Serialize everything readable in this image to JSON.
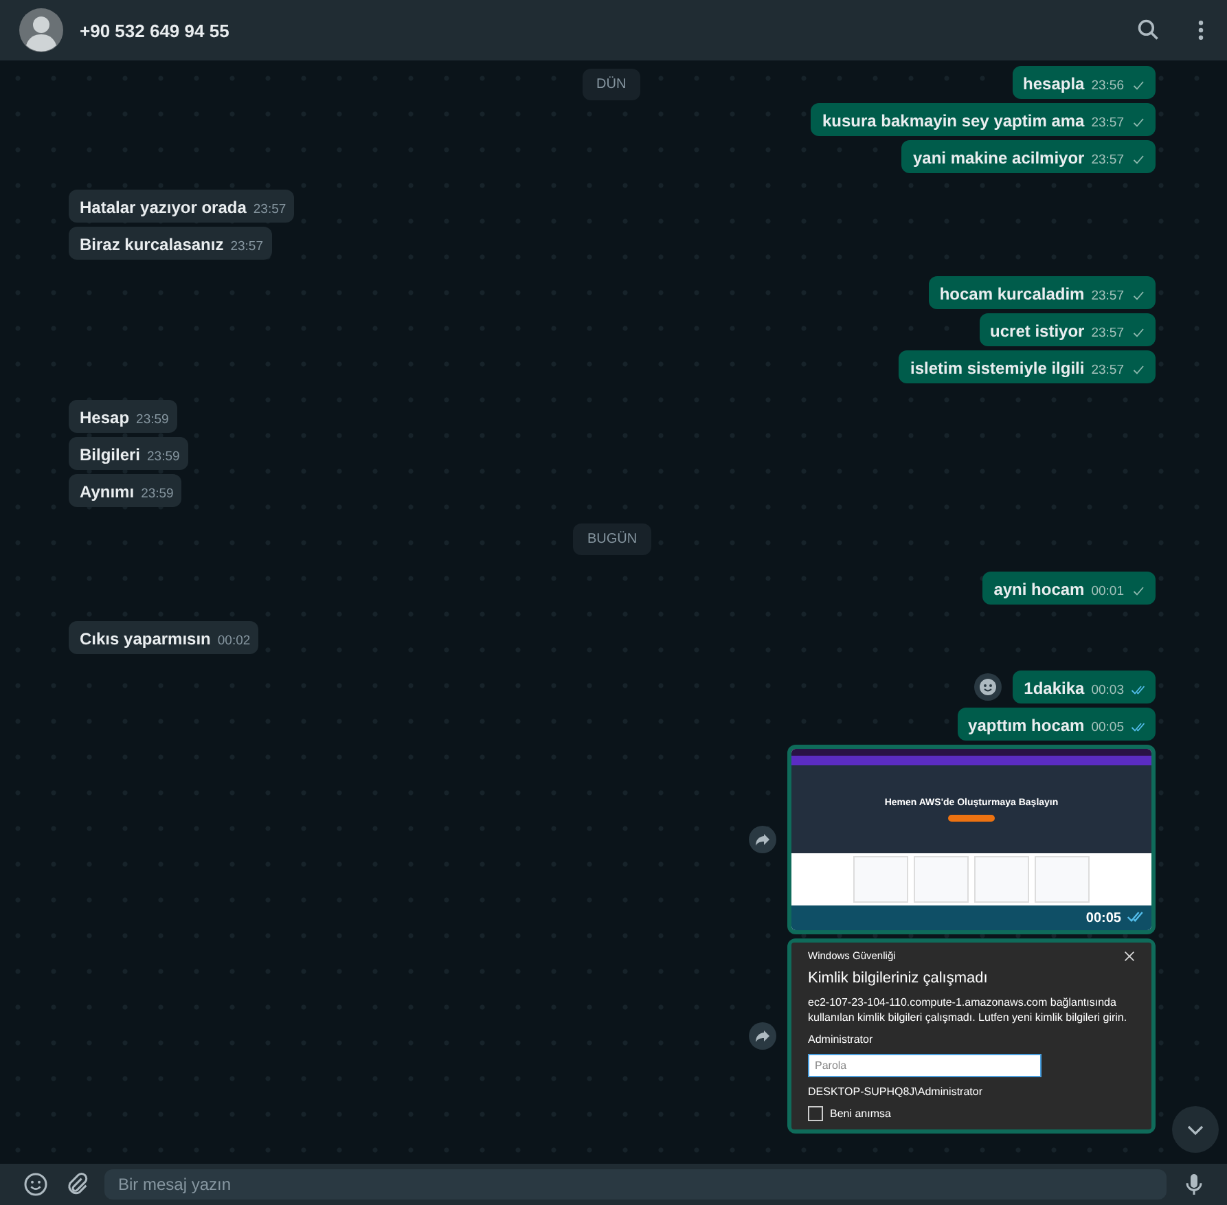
{
  "header": {
    "contact": "+90 532 649 94 55"
  },
  "date_pinned": "DÜN",
  "messages": [
    {
      "kind": "text",
      "outgoing": true,
      "text": "hesapla",
      "time": "23:56",
      "read": false
    },
    {
      "kind": "text",
      "outgoing": true,
      "text": "kusura bakmayin sey yaptim ama",
      "time": "23:57",
      "read": false
    },
    {
      "kind": "text",
      "outgoing": true,
      "text": "yani makine acilmiyor",
      "time": "23:57",
      "read": false
    },
    {
      "kind": "text",
      "outgoing": false,
      "text": "Hatalar yazıyor orada",
      "time": "23:57"
    },
    {
      "kind": "text",
      "outgoing": false,
      "text": "Biraz kurcalasanız",
      "time": "23:57"
    },
    {
      "kind": "text",
      "outgoing": true,
      "text": "hocam kurcaladim",
      "time": "23:57",
      "read": false
    },
    {
      "kind": "text",
      "outgoing": true,
      "text": "ucret istiyor",
      "time": "23:57",
      "read": false
    },
    {
      "kind": "text",
      "outgoing": true,
      "text": "isletim sistemiyle ilgili",
      "time": "23:57",
      "read": false
    },
    {
      "kind": "text",
      "outgoing": false,
      "text": "Hesap",
      "time": "23:59"
    },
    {
      "kind": "text",
      "outgoing": false,
      "text": "Bilgileri",
      "time": "23:59"
    },
    {
      "kind": "text",
      "outgoing": false,
      "text": "Aynımı",
      "time": "23:59"
    },
    {
      "kind": "date",
      "text": "BUGÜN"
    },
    {
      "kind": "text",
      "outgoing": true,
      "text": "ayni hocam",
      "time": "00:01",
      "read": false
    },
    {
      "kind": "text",
      "outgoing": false,
      "text": "Cıkıs yaparmısın",
      "time": "00:02"
    },
    {
      "kind": "text",
      "outgoing": true,
      "text": "1dakika",
      "time": "00:03",
      "read": true,
      "reaction_button": true
    },
    {
      "kind": "text",
      "outgoing": true,
      "text": "yapttım hocam",
      "time": "00:05",
      "read": true
    },
    {
      "kind": "web-screenshot",
      "headline": "Hemen AWS'de Oluşturmaya Başlayın",
      "time": "00:05",
      "read": true
    },
    {
      "kind": "dialog-screenshot",
      "dialog": {
        "window_title": "Windows Güvenliği",
        "heading": "Kimlik bilgileriniz çalışmadı",
        "message": "ec2-107-23-104-110.compute-1.amazonaws.com bağlantısında kullanılan kimlik bilgileri çalışmadı. Lutfen yeni kimlik bilgileri girin.",
        "username": "Administrator",
        "password_placeholder": "Parola",
        "domain_user": "DESKTOP-SUPHQ8J\\Administrator",
        "remember": {
          "label": "Beni anımsa",
          "checked": false
        }
      }
    }
  ],
  "composer": {
    "placeholder": "Bir mesaj yazın"
  }
}
